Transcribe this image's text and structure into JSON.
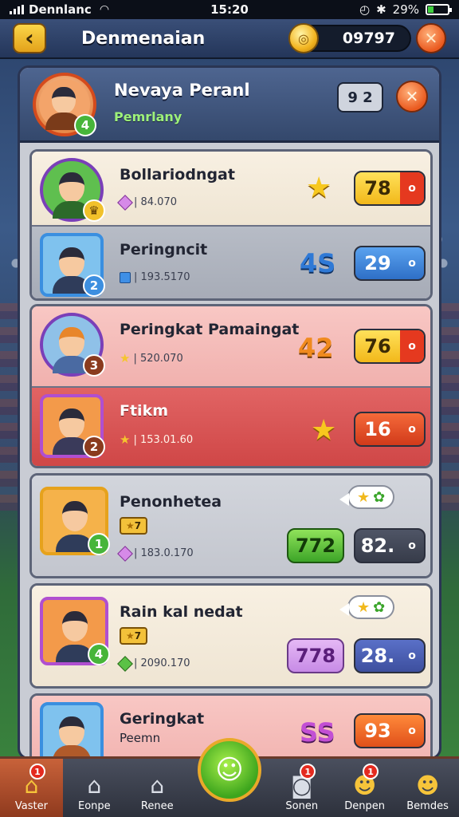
{
  "statusbar": {
    "carrier": "Dennlanc",
    "time": "15:20",
    "battery": "29%",
    "battery_level": 0.29
  },
  "header": {
    "back_icon": "chevron-left-icon",
    "title": "Denmenaian",
    "coins": "09797",
    "close_icon": "close-icon"
  },
  "profile": {
    "name": "Nevaya Peranl",
    "subtitle": "Pemrlany",
    "level": "4",
    "counter": "9 2"
  },
  "groups": [
    {
      "rows": [
        {
          "name": "Bollariodngat",
          "meta": "| 84.070",
          "level": "",
          "value": "78",
          "pill_cap": "o",
          "badge": "star"
        },
        {
          "name": "Peringncit",
          "meta": "| 193.5170",
          "level": "2",
          "value": "29",
          "pill_cap": "o",
          "big": "4S"
        }
      ]
    },
    {
      "rows": [
        {
          "name": "Peringkat Pamaingat",
          "meta": "| 520.070",
          "level": "3",
          "value": "76",
          "pill_cap": "o",
          "big": "42"
        },
        {
          "name": "Ftikm",
          "meta": "| 153.01.60",
          "level": "2",
          "value": "16",
          "pill_cap": "o",
          "badge": "star"
        }
      ]
    },
    {
      "rows": [
        {
          "name": "Penonhetea",
          "tag": "7",
          "meta": "| 183.0.170",
          "level": "1",
          "value": "772",
          "value2": "82.",
          "pill_cap": "o"
        }
      ]
    },
    {
      "rows": [
        {
          "name": "Rain kal nedat",
          "tag": "7",
          "meta": "| 2090.170",
          "level": "4",
          "value": "778",
          "value2": "28.",
          "pill_cap": "o"
        }
      ]
    },
    {
      "rows": [
        {
          "name": "Geringkat",
          "sub": "Peemn",
          "big": "SS",
          "value": "93",
          "pill_cap": "o"
        }
      ]
    }
  ],
  "nav": {
    "items": [
      {
        "label": "Vaster",
        "badge": "1"
      },
      {
        "label": "Eonpe",
        "badge": ""
      },
      {
        "label": "Renee",
        "badge": ""
      },
      {
        "label": "",
        "badge": ""
      },
      {
        "label": "Sonen",
        "badge": "1"
      },
      {
        "label": "Denpen",
        "badge": "1"
      },
      {
        "label": "Bemdes",
        "badge": ""
      }
    ]
  }
}
